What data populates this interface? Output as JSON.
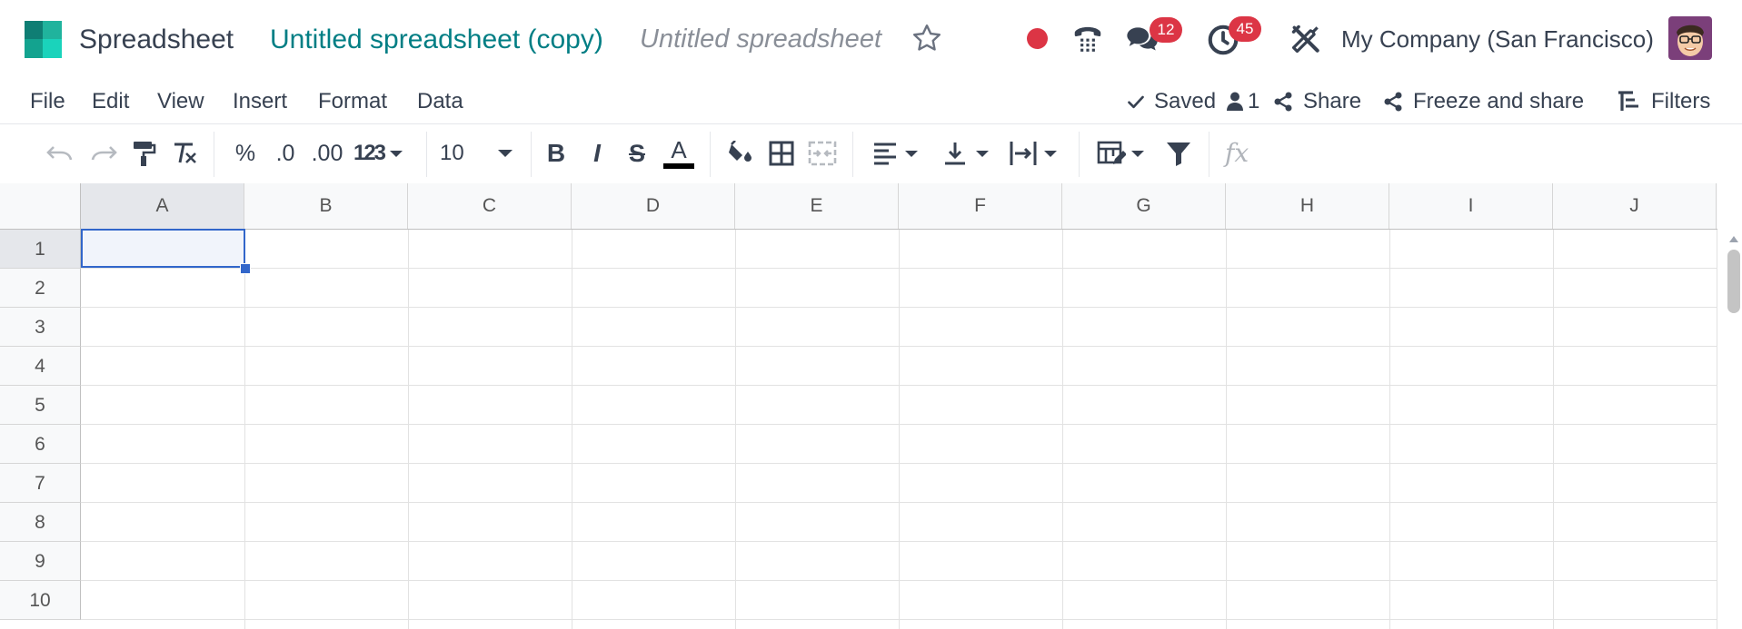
{
  "app": {
    "name": "Spreadsheet",
    "logo_icon": "spreadsheet-logo-icon"
  },
  "document": {
    "title": "Untitled spreadsheet (copy)",
    "subtitle": "Untitled spreadsheet"
  },
  "systray": {
    "status_color": "#dc3545",
    "messages_count": "12",
    "activities_count": "45",
    "company": "My Company (San Francisco)"
  },
  "menu": {
    "items": [
      "File",
      "Edit",
      "View",
      "Insert",
      "Format",
      "Data"
    ]
  },
  "actions": {
    "saved": "Saved",
    "users_count": "1",
    "share": "Share",
    "freeze_share": "Freeze and share",
    "filters": "Filters"
  },
  "toolbar": {
    "percent": "%",
    "decrease_decimal": ".0",
    "increase_decimal": ".00",
    "number_format": "123",
    "font_size": "10",
    "bold": "B",
    "italic": "I",
    "strike": "S",
    "text_color_letter": "A",
    "formula_placeholder": "fx"
  },
  "grid": {
    "columns": [
      "A",
      "B",
      "C",
      "D",
      "E",
      "F",
      "G",
      "H",
      "I",
      "J"
    ],
    "rows": [
      "1",
      "2",
      "3",
      "4",
      "5",
      "6",
      "7",
      "8",
      "9",
      "10"
    ],
    "selected_cell": "A1"
  },
  "colors": {
    "brand_teal": "#017e84",
    "selection": "#3266ca",
    "badge": "#dc3545"
  }
}
